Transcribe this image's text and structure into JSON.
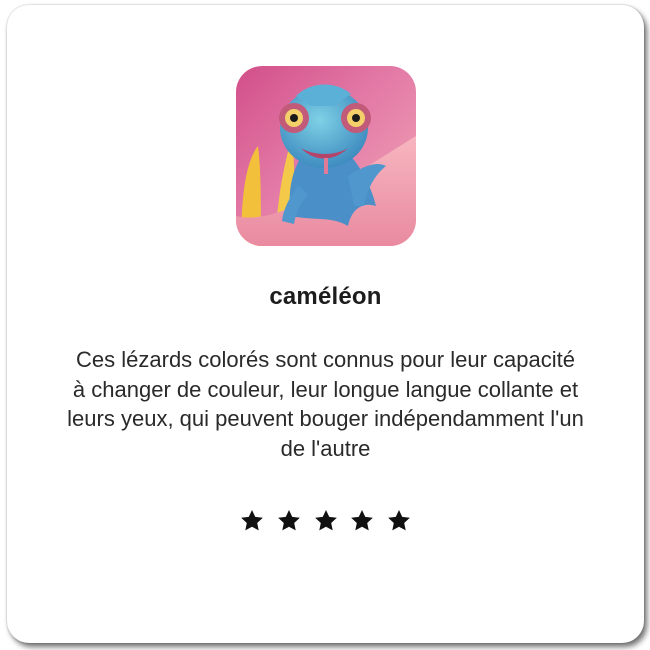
{
  "card": {
    "title": "caméléon",
    "description": "Ces lézards colorés sont connus pour leur capacité à changer de couleur, leur longue langue collante et leurs yeux, qui peuvent bouger indépendamment l'un de l'autre",
    "image_icon": "chameleon-photo",
    "rating": 5,
    "rating_max": 5,
    "star_icon": "star-icon"
  },
  "colors": {
    "background": "#ffffff",
    "text": "#1d1d1d",
    "star": "#111111"
  }
}
